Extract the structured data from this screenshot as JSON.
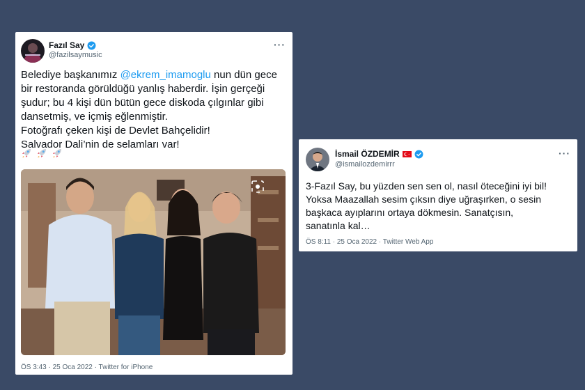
{
  "tweet1": {
    "name": "Fazıl Say",
    "handle": "@fazilsaymusic",
    "more": "···",
    "text_before": "Belediye başkanımız ",
    "mention": "@ekrem_imamoglu",
    "text_after": " nun dün gece\nbir restoranda görüldüğü yanlış haberdir. İşin gerçeği\nşudur; bu 4 kişi dün bütün gece diskoda çılgınlar gibi\ndansetmiş, ve içmiş eğlenmiştir.\nFotoğrafı çeken kişi de Devlet Bahçelidir!\nSalvador Dali’nin de selamları var!",
    "emoji": [
      "rocket-icon",
      "rocket-icon",
      "rocket-icon"
    ],
    "meta": "ÖS 3:43 · 25 Oca 2022 · Twitter for iPhone"
  },
  "tweet2": {
    "name": "İsmail ÖZDEMİR",
    "handle": "@ismailozdemirrr",
    "more": "···",
    "text": "3-Fazıl Say, bu yüzden sen sen ol, nasıl öteceğini iyi bil!\nYoksa Maazallah sesim çıksın diye uğraşırken, o sesin\nbaşkaca ayıplarını ortaya dökmesin. Sanatçısın,\nsanatınla kal…",
    "meta": "ÖS 8:11 · 25 Oca 2022 · Twitter Web App"
  },
  "colors": {
    "background": "#3a4a66",
    "mention": "#1d9bf0",
    "verified": "#1d9bf0",
    "text": "#0f1419",
    "secondary": "#536471"
  }
}
